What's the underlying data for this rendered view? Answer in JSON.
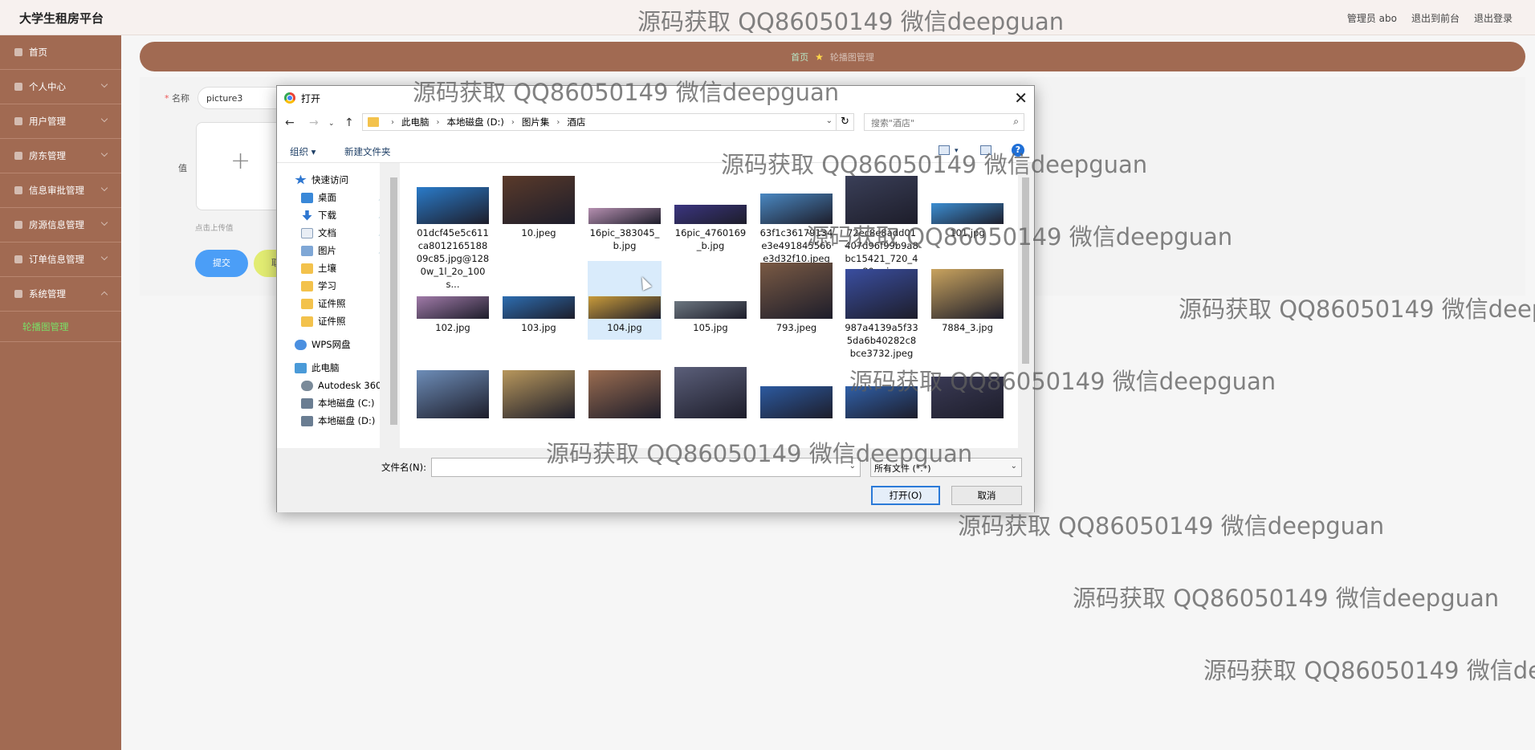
{
  "header": {
    "brand": "大学生租房平台",
    "links": [
      "管理员 abo",
      "退出到前台",
      "退出登录"
    ]
  },
  "sidebar": {
    "items": [
      {
        "label": "首页",
        "icon": "home-icon",
        "expandable": false
      },
      {
        "label": "个人中心",
        "icon": "user-icon",
        "expandable": true
      },
      {
        "label": "用户管理",
        "icon": "users-icon",
        "expandable": true
      },
      {
        "label": "房东管理",
        "icon": "landlord-icon",
        "expandable": true
      },
      {
        "label": "信息审批管理",
        "icon": "approval-icon",
        "expandable": true
      },
      {
        "label": "房源信息管理",
        "icon": "house-icon",
        "expandable": true
      },
      {
        "label": "订单信息管理",
        "icon": "order-icon",
        "expandable": true
      },
      {
        "label": "系统管理",
        "icon": "system-icon",
        "expandable": true,
        "expanded": true
      }
    ],
    "subitem": "轮播图管理",
    "colors": {
      "bg": "#a16a52",
      "active_sub": "#79e067"
    }
  },
  "breadcrumb": {
    "home": "首页",
    "current": "轮播图管理"
  },
  "form": {
    "name_label": "名称",
    "name_value": "picture3",
    "value_label": "值",
    "upload_hint": "点击上传值",
    "submit": "提交",
    "reset": "取"
  },
  "dialog": {
    "title": "打开",
    "path": [
      "此电脑",
      "本地磁盘 (D:)",
      "图片集",
      "酒店"
    ],
    "search_placeholder": "搜索\"酒店\"",
    "toolbar": {
      "organize": "组织",
      "new_folder": "新建文件夹",
      "help": "?"
    },
    "nav": {
      "quick_access": "快速访问",
      "items": [
        {
          "label": "桌面",
          "pinned": true,
          "icon": "desktop-icon"
        },
        {
          "label": "下载",
          "pinned": true,
          "icon": "download-icon"
        },
        {
          "label": "文档",
          "pinned": true,
          "icon": "document-icon"
        },
        {
          "label": "图片",
          "pinned": true,
          "icon": "pictures-icon"
        },
        {
          "label": "土壤",
          "pinned": false,
          "icon": "folder-icon"
        },
        {
          "label": "学习",
          "pinned": false,
          "icon": "folder-icon"
        },
        {
          "label": "证件照",
          "pinned": false,
          "icon": "folder-icon"
        },
        {
          "label": "证件照",
          "pinned": false,
          "icon": "folder-icon"
        }
      ],
      "wps": "WPS网盘",
      "this_pc": "此电脑",
      "drives": [
        "Autodesk 360",
        "本地磁盘 (C:)",
        "本地磁盘 (D:)"
      ]
    },
    "files": [
      {
        "name": "01dcf45e5c611ca801216518809c85.jpg@1280w_1l_2o_100s...",
        "color": "#2a7bc9"
      },
      {
        "name": "10.jpeg",
        "color": "#5a3a2a"
      },
      {
        "name": "16pic_383045_b.jpg",
        "color": "#b58fb0"
      },
      {
        "name": "16pic_4760169_b.jpg",
        "color": "#3b3580"
      },
      {
        "name": "63f1c36179134e3e491845566e3d32f10.jpeg",
        "color": "#4a88c2"
      },
      {
        "name": "72ec8e8add01407d96f99b9a8bc15421_720_480_s.jpg",
        "color": "#3a3f58"
      },
      {
        "name": "101.jpg",
        "color": "#3c8ed2"
      },
      {
        "name": "102.jpg",
        "color": "#a07aa8"
      },
      {
        "name": "103.jpg",
        "color": "#2d6db0"
      },
      {
        "name": "104.jpg",
        "color": "#c89a3a",
        "selected": true
      },
      {
        "name": "105.jpg",
        "color": "#6c7680"
      },
      {
        "name": "793.jpeg",
        "color": "#7a5a44"
      },
      {
        "name": "987a4139a5f335da6b40282c8bce3732.jpeg",
        "color": "#3a4ea0"
      },
      {
        "name": "7884_3.jpg",
        "color": "#c9a35e"
      },
      {
        "name": "",
        "color": "#6d8db8"
      },
      {
        "name": "",
        "color": "#b8975c"
      },
      {
        "name": "",
        "color": "#9a6c50"
      },
      {
        "name": "",
        "color": "#5b5f7a"
      },
      {
        "name": "",
        "color": "#2c5aa0"
      },
      {
        "name": "",
        "color": "#3060a8"
      },
      {
        "name": "",
        "color": "#3a3a55"
      }
    ],
    "filename_label": "文件名(N):",
    "filename_value": "",
    "filetype": "所有文件 (*.*)",
    "open_button": "打开(O)",
    "cancel_button": "取消"
  },
  "watermark": "源码获取 QQ86050149 微信deepguan"
}
